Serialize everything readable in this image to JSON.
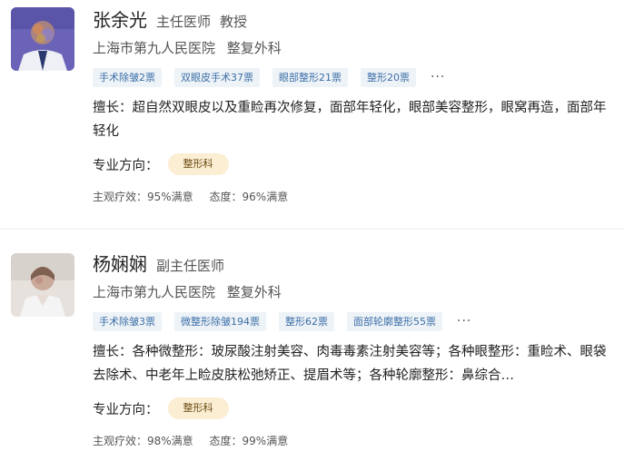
{
  "doctors": [
    {
      "name": "张余光",
      "title": "主任医师",
      "academic_title": "教授",
      "hospital": "上海市第九人民医院",
      "department": "整复外科",
      "tags": [
        "手术除皱2票",
        "双眼皮手术37票",
        "眼部整形21票",
        "整形20票"
      ],
      "more": "···",
      "expertise": "擅长：超自然双眼皮以及重睑再次修复，面部年轻化，眼部美容整形，眼窝再造，面部年轻化",
      "direction_label": "专业方向：",
      "direction": "整形科",
      "efficacy": "主观疗效：95%满意",
      "attitude": "态度：96%满意"
    },
    {
      "name": "杨娴娴",
      "title": "副主任医师",
      "hospital": "上海市第九人民医院",
      "department": "整复外科",
      "tags": [
        "手术除皱3票",
        "微整形除皱194票",
        "整形62票",
        "面部轮廓整形55票"
      ],
      "more": "···",
      "expertise": "擅长：各种微整形：玻尿酸注射美容、肉毒毒素注射美容等；各种眼整形：重睑术、眼袋去除术、中老年上睑皮肤松弛矫正、提眉术等；各种轮廓整形：鼻综合…",
      "direction_label": "专业方向：",
      "direction": "整形科",
      "efficacy": "主观疗效：98%满意",
      "attitude": "态度：99%满意"
    }
  ]
}
